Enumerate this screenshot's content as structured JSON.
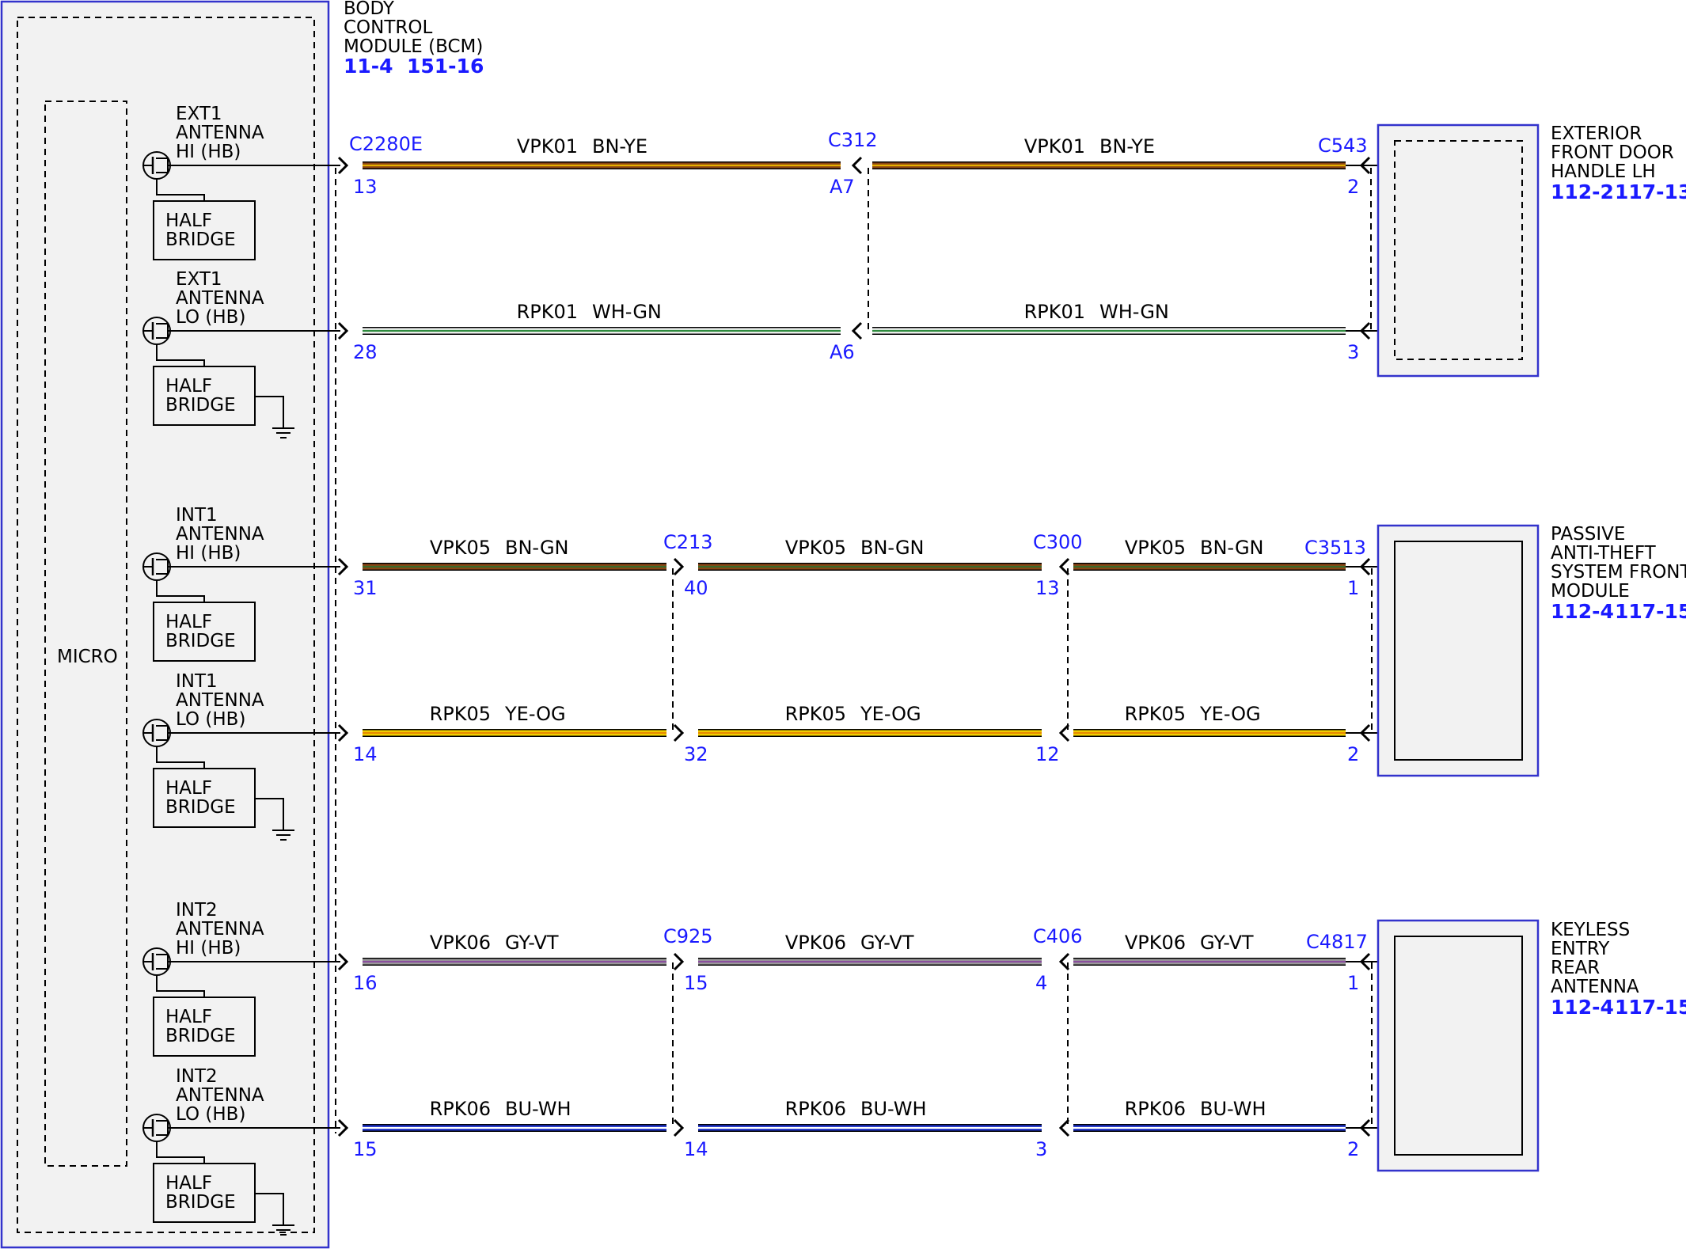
{
  "bcm": {
    "title": [
      "BODY",
      "CONTROL",
      "MODULE (BCM)"
    ],
    "refs": [
      "11-4",
      "151-16"
    ],
    "micro_label": "MICRO",
    "antennas": [
      {
        "lines": [
          "EXT1",
          "ANTENNA",
          "HI (HB)"
        ],
        "bridge": [
          "HALF",
          "BRIDGE"
        ]
      },
      {
        "lines": [
          "EXT1",
          "ANTENNA",
          "LO (HB)"
        ],
        "bridge": [
          "HALF",
          "BRIDGE"
        ]
      },
      {
        "lines": [
          "INT1",
          "ANTENNA",
          "HI (HB)"
        ],
        "bridge": [
          "HALF",
          "BRIDGE"
        ]
      },
      {
        "lines": [
          "INT1",
          "ANTENNA",
          "LO (HB)"
        ],
        "bridge": [
          "HALF",
          "BRIDGE"
        ]
      },
      {
        "lines": [
          "INT2",
          "ANTENNA",
          "HI (HB)"
        ],
        "bridge": [
          "HALF",
          "BRIDGE"
        ]
      },
      {
        "lines": [
          "INT2",
          "ANTENNA",
          "LO (HB)"
        ],
        "bridge": [
          "HALF",
          "BRIDGE"
        ]
      }
    ]
  },
  "wires": [
    {
      "segments": [
        {
          "circuit": "VPK01",
          "color": "BN-YE"
        },
        {
          "circuit": "VPK01",
          "color": "BN-YE"
        }
      ],
      "pins": [
        "13",
        "A7",
        "2"
      ],
      "stripe": [
        "#8b4513",
        "#e5b000"
      ]
    },
    {
      "segments": [
        {
          "circuit": "RPK01",
          "color": "WH-GN"
        },
        {
          "circuit": "RPK01",
          "color": "WH-GN"
        }
      ],
      "pins": [
        "28",
        "A6",
        "3"
      ],
      "stripe": [
        "#f2f2f2",
        "#2e8b3e"
      ]
    },
    {
      "segments": [
        {
          "circuit": "VPK05",
          "color": "BN-GN"
        },
        {
          "circuit": "VPK05",
          "color": "BN-GN"
        },
        {
          "circuit": "VPK05",
          "color": "BN-GN"
        }
      ],
      "pins": [
        "31",
        "40",
        "13",
        "1"
      ],
      "stripe": [
        "#8b4513",
        "#3a6a2a"
      ]
    },
    {
      "segments": [
        {
          "circuit": "RPK05",
          "color": "YE-OG"
        },
        {
          "circuit": "RPK05",
          "color": "YE-OG"
        },
        {
          "circuit": "RPK05",
          "color": "YE-OG"
        }
      ],
      "pins": [
        "14",
        "32",
        "12",
        "2"
      ],
      "stripe": [
        "#f2d200",
        "#e68a00"
      ]
    },
    {
      "segments": [
        {
          "circuit": "VPK06",
          "color": "GY-VT"
        },
        {
          "circuit": "VPK06",
          "color": "GY-VT"
        },
        {
          "circuit": "VPK06",
          "color": "GY-VT"
        }
      ],
      "pins": [
        "16",
        "15",
        "4",
        "1"
      ],
      "stripe": [
        "#9a9a9a",
        "#8a4f9e"
      ]
    },
    {
      "segments": [
        {
          "circuit": "RPK06",
          "color": "BU-WH"
        },
        {
          "circuit": "RPK06",
          "color": "BU-WH"
        },
        {
          "circuit": "RPK06",
          "color": "BU-WH"
        }
      ],
      "pins": [
        "15",
        "14",
        "3",
        "2"
      ],
      "stripe": [
        "#1a2fc8",
        "#ffffff"
      ]
    }
  ],
  "connectors": {
    "group1": [
      "C2280E",
      "C312",
      "C543"
    ],
    "group2": [
      "C213",
      "C300",
      "C3513"
    ],
    "group3": [
      "C925",
      "C406",
      "C4817"
    ]
  },
  "components": [
    {
      "lines": [
        "EXTERIOR",
        "FRONT DOOR",
        "HANDLE LH"
      ],
      "refs": [
        "112-2",
        "117-13"
      ]
    },
    {
      "lines": [
        "PASSIVE",
        "ANTI-THEFT",
        "SYSTEM FRONT",
        "MODULE"
      ],
      "refs": [
        "112-4",
        "117-15"
      ]
    },
    {
      "lines": [
        "KEYLESS",
        "ENTRY",
        "REAR",
        "ANTENNA"
      ],
      "refs": [
        "112-4",
        "117-15"
      ]
    }
  ],
  "colors": {
    "ref_blue": "#1a1aff",
    "module_fill": "#f2f2f2",
    "module_border": "#3333cc"
  }
}
